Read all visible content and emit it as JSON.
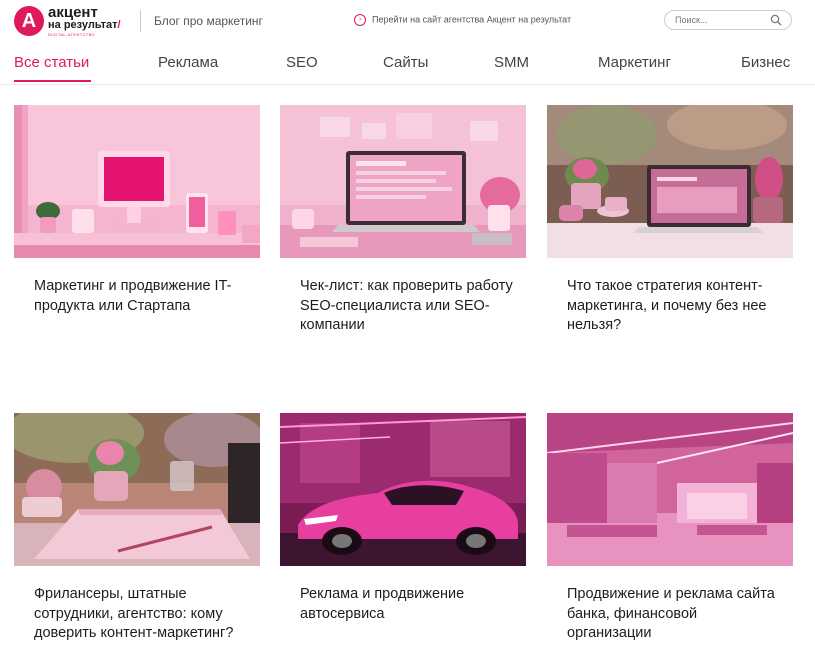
{
  "header": {
    "logo_letter": "А",
    "logo_line1": "акцент",
    "logo_line2": "на результат",
    "logo_line3": "DIGITAL-АГЕНТСТВО",
    "blog_title": "Блог про маркетинг",
    "agency_link": "Перейти на сайт агентства Акцент на результат",
    "search_placeholder": "Поиск..."
  },
  "tabs": [
    {
      "label": "Все статьи",
      "active": true
    },
    {
      "label": "Реклама"
    },
    {
      "label": "SEO"
    },
    {
      "label": "Сайты"
    },
    {
      "label": "SMM"
    },
    {
      "label": "Маркетинг"
    },
    {
      "label": "Бизнес"
    }
  ],
  "articles": [
    {
      "title": "Маркетинг и продвижение IT-продукта или Стартапа"
    },
    {
      "title": "Чек-лист: как проверить работу SEO-специалиста или SEO-компании"
    },
    {
      "title": "Что такое стратегия контент-маркетинга, и почему без нее нельзя?"
    },
    {
      "title": "Фрилансеры, штатные сотрудники, агентство: кому доверить контент-маркетинг?"
    },
    {
      "title": "Реклама и продвижение автосервиса"
    },
    {
      "title": "Продвижение и реклама сайта банка, финансовой организации"
    }
  ],
  "colors": {
    "accent": "#e0195a"
  }
}
